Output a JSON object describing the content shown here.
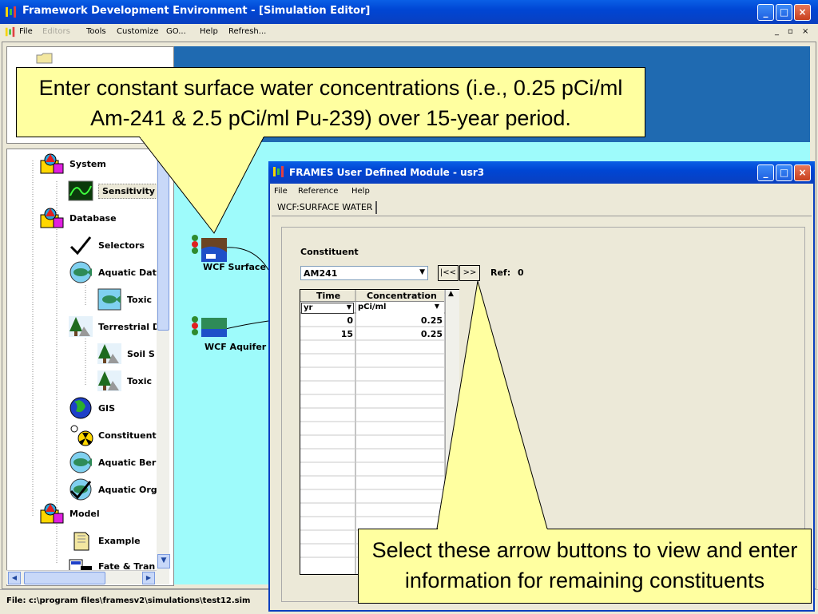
{
  "main_window": {
    "title": "Framework Development Environment - [Simulation Editor]",
    "minimize": "_",
    "maximize": "□",
    "close": "×",
    "mdi_controls": [
      "_",
      "▫",
      "×"
    ]
  },
  "menu": [
    {
      "label": "File",
      "enabled": true
    },
    {
      "label": "Editors",
      "enabled": false
    },
    {
      "label": "Tools",
      "enabled": true
    },
    {
      "label": "Customize",
      "enabled": true
    },
    {
      "label": "GO...",
      "enabled": true
    },
    {
      "label": "Help",
      "enabled": true
    },
    {
      "label": "Refresh...",
      "enabled": true
    }
  ],
  "tree": [
    {
      "label": "System",
      "icon": "system-icon"
    },
    {
      "label": "Sensitivity",
      "icon": "sensitivity-icon",
      "selected": true
    },
    {
      "label": "Database",
      "icon": "database-icon"
    },
    {
      "label": "Selectors",
      "icon": "checkmark-icon"
    },
    {
      "label": "Aquatic Dat",
      "icon": "fish-icon"
    },
    {
      "label": "Toxic",
      "icon": "fish-icon"
    },
    {
      "label": "Terrestrial D",
      "icon": "tree-icon"
    },
    {
      "label": "Soil S",
      "icon": "tree-icon"
    },
    {
      "label": "Toxic",
      "icon": "tree-icon"
    },
    {
      "label": "GIS",
      "icon": "globe-icon"
    },
    {
      "label": "Constituent",
      "icon": "molecule-icon"
    },
    {
      "label": "Aquatic Ber",
      "icon": "fish-icon"
    },
    {
      "label": "Aquatic Org",
      "icon": "fish-check-icon"
    },
    {
      "label": "Model",
      "icon": "model-icon"
    },
    {
      "label": "Example",
      "icon": "example-icon"
    },
    {
      "label": "Fate & Tran",
      "icon": "fate-icon"
    }
  ],
  "canvas": {
    "modules": [
      {
        "label": "WCF Surface"
      },
      {
        "label": "WCF Aquifer I"
      }
    ]
  },
  "status_bar": "File: c:\\program files\\framesv2\\simulations\\test12.sim",
  "sub_window": {
    "title": "FRAMES User Defined Module - usr3",
    "menu": [
      "File",
      "Reference",
      "Help"
    ],
    "tab": "WCF:SURFACE WATER",
    "constituent_label": "Constituent",
    "constituent_value": "AM241",
    "prev_button": "|<<",
    "next_button": ">>",
    "ref_label": "Ref:",
    "ref_value": "0",
    "table": {
      "headers": [
        "Time",
        "Concentration"
      ],
      "units": [
        "yr",
        "pCi/ml"
      ],
      "rows": [
        [
          "0",
          "0.25"
        ],
        [
          "15",
          "0.25"
        ]
      ]
    }
  },
  "callouts": {
    "top": "Enter constant surface water concentrations (i.e., 0.25 pCi/ml Am-241 & 2.5 pCi/ml Pu-239) over 15-year period.",
    "bottom": "Select these arrow buttons to view and enter information for remaining constituents"
  }
}
